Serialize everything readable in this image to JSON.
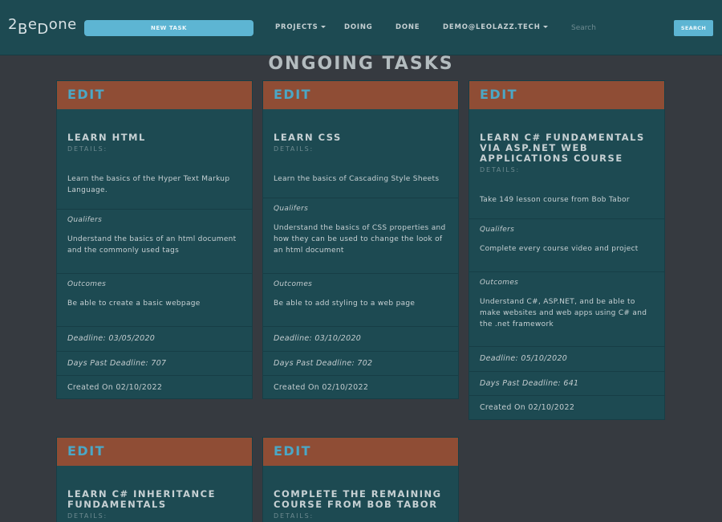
{
  "nav": {
    "logo": {
      "c1": "2",
      "c2": "B",
      "c3": "e",
      "c4": "D",
      "c5": "one"
    },
    "new_task_label": "NEW TASK",
    "projects_label": "PROJECTS",
    "doing_label": "DOING",
    "done_label": "DONE",
    "user_label": "DEMO@LEOLAZZ.TECH",
    "search_placeholder": "Search",
    "search_button_label": "SEARCH"
  },
  "page_title": "ONGOING TASKS",
  "cards": [
    {
      "edit_label": "EDIT",
      "name": "LEARN HTML",
      "details_label": "DETAILS:",
      "details": "Learn the basics of the Hyper Text Markup Language.",
      "qualifiers_label": "Qualifers",
      "qualifiers": "Understand the basics of an html document and the commonly used tags",
      "outcomes_label": "Outcomes",
      "outcomes": "Be able to create a basic webpage",
      "deadline": "Deadline: 03/05/2020",
      "days_past": "Days Past Deadline: 707",
      "created": "Created On 02/10/2022"
    },
    {
      "edit_label": "EDIT",
      "name": "LEARN CSS",
      "details_label": "DETAILS:",
      "details": "Learn the basics of Cascading Style Sheets",
      "qualifiers_label": "Qualifers",
      "qualifiers": "Understand the basics of CSS properties and how they can be used to change the look of an html document",
      "outcomes_label": "Outcomes",
      "outcomes": "Be able to add styling to a web page",
      "deadline": "Deadline: 03/10/2020",
      "days_past": "Days Past Deadline: 702",
      "created": "Created On 02/10/2022"
    },
    {
      "edit_label": "EDIT",
      "name": "LEARN C# FUNDAMENTALS VIA ASP.NET WEB APPLICATIONS COURSE",
      "details_label": "DETAILS:",
      "details": "Take 149 lesson course from Bob Tabor",
      "qualifiers_label": "Qualifers",
      "qualifiers": "Complete every course video and project",
      "outcomes_label": "Outcomes",
      "outcomes": "Understand C#, ASP.NET, and be able to make websites and web apps using C# and the .net framework",
      "deadline": "Deadline: 05/10/2020",
      "days_past": "Days Past Deadline: 641",
      "created": "Created On 02/10/2022"
    },
    {
      "edit_label": "EDIT",
      "name": "LEARN C# INHERITANCE FUNDAMENTALS",
      "details_label": "DETAILS:"
    },
    {
      "edit_label": "EDIT",
      "name": "COMPLETE THE REMAINING COURSE FROM BOB TABOR",
      "details_label": "DETAILS:"
    }
  ]
}
